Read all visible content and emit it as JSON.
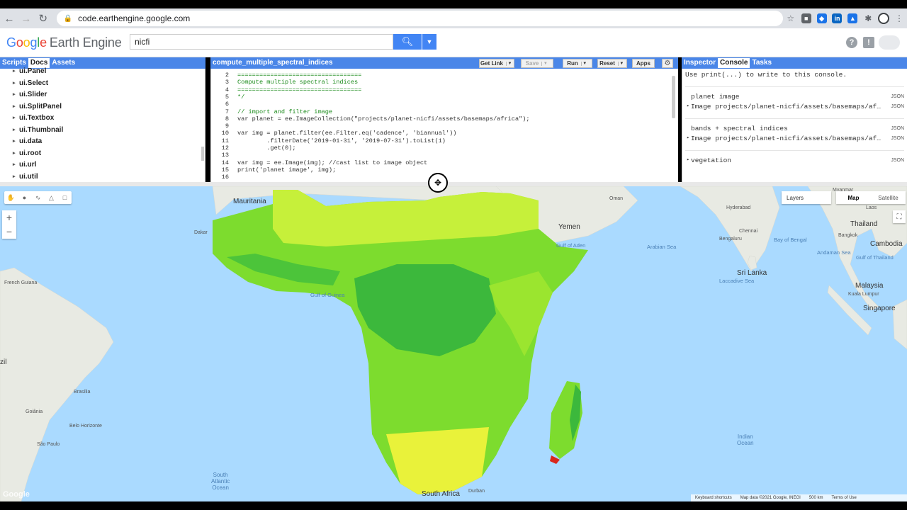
{
  "browser": {
    "url": "code.earthengine.google.com"
  },
  "header": {
    "logo_google": [
      "G",
      "o",
      "o",
      "g",
      "l",
      "e"
    ],
    "logo_product": "Earth Engine",
    "search_value": "nicfi"
  },
  "left_panel": {
    "tabs": [
      "Scripts",
      "Docs",
      "Assets"
    ],
    "active_tab": "Docs",
    "items": [
      "ui.Panel",
      "ui.Select",
      "ui.Slider",
      "ui.SplitPanel",
      "ui.Textbox",
      "ui.Thumbnail",
      "ui.data",
      "ui.root",
      "ui.url",
      "ui.util"
    ]
  },
  "editor": {
    "title": "compute_multiple_spectral_indices",
    "buttons": {
      "get_link": "Get Link",
      "save": "Save",
      "run": "Run",
      "reset": "Reset",
      "apps": "Apps"
    },
    "lines": [
      {
        "n": "2",
        "text": "=================================="
      },
      {
        "n": "3",
        "text": "Compute multiple spectral indices"
      },
      {
        "n": "4",
        "text": "=================================="
      },
      {
        "n": "5",
        "text": "*/"
      },
      {
        "n": "6",
        "text": ""
      },
      {
        "n": "7",
        "text": "// import and filter image"
      },
      {
        "n": "8",
        "text": "var planet = ee.ImageCollection(\"projects/planet-nicfi/assets/basemaps/africa\");"
      },
      {
        "n": "9",
        "text": ""
      },
      {
        "n": "10",
        "text": "var img = planet.filter(ee.Filter.eq('cadence', 'biannual'))"
      },
      {
        "n": "11",
        "text": "        .filterDate('2019-01-31', '2019-07-31').toList(1)"
      },
      {
        "n": "12",
        "text": "        .get(0);"
      },
      {
        "n": "13",
        "text": ""
      },
      {
        "n": "14",
        "text": "var img = ee.Image(img); //cast list to image object"
      },
      {
        "n": "15",
        "text": "print('planet image', img);"
      },
      {
        "n": "16",
        "text": ""
      }
    ]
  },
  "console": {
    "tabs": [
      "Inspector",
      "Console",
      "Tasks"
    ],
    "active_tab": "Console",
    "hint": "Use print(...) to write to this console.",
    "entries": [
      {
        "label": "planet image",
        "json": "JSON"
      },
      {
        "label": "Image projects/planet-nicfi/assets/basemaps/af…",
        "json": "JSON"
      },
      {
        "label": "bands + spectral indices",
        "json": "JSON"
      },
      {
        "label": "Image projects/planet-nicfi/assets/basemaps/af…",
        "json": "JSON"
      },
      {
        "label": "vegetation",
        "json": "JSON"
      }
    ]
  },
  "map": {
    "layers_label": "Layers",
    "map_types": [
      "Map",
      "Satellite"
    ],
    "active_map_type": "Map",
    "labels": {
      "mauritania": "Mauritania",
      "yemen": "Yemen",
      "oman": "Oman",
      "gulf_aden": "Gulf of Aden",
      "arabian_sea": "Arabian Sea",
      "hyderabad": "Hyderabad",
      "chennai": "Chennai",
      "bangalore": "Bengaluru",
      "thailand": "Thailand",
      "bangkok": "Bangkok",
      "cambodia": "Cambodia",
      "bay_bengal": "Bay of Bengal",
      "andaman": "Andaman Sea",
      "gulf_thailand": "Gulf of Thailand",
      "sri_lanka": "Sri Lanka",
      "laccadive": "Laccadive Sea",
      "malaysia": "Malaysia",
      "kuala_lumpur": "Kuala Lumpur",
      "singapore": "Singapore",
      "gulf_guinea": "Gulf of Guinea",
      "french_guiana": "French Guiana",
      "brazil": "zil",
      "brasilia": "Brasília",
      "goiania": "Goiânia",
      "belo": "Belo Horizonte",
      "sao_paulo": "São Paulo",
      "south_atlantic": "South\nAtlantic\nOcean",
      "indian_ocean": "Indian\nOcean",
      "south_africa": "South Africa",
      "durban": "Durban",
      "dakar": "Dakar",
      "laos": "Laos",
      "myanmar": "Myanmar"
    },
    "attribution": [
      "Keyboard shortcuts",
      "Map data ©2021 Google, INEGI",
      "500 km",
      "Terms of Use"
    ],
    "colors": {
      "water": "#aadaff",
      "land": "#e8eae3",
      "veg_dark": "#3cb83c",
      "veg_mid": "#7ddc2e",
      "veg_light": "#c6f03a",
      "veg_yellow": "#e9f23a"
    }
  }
}
